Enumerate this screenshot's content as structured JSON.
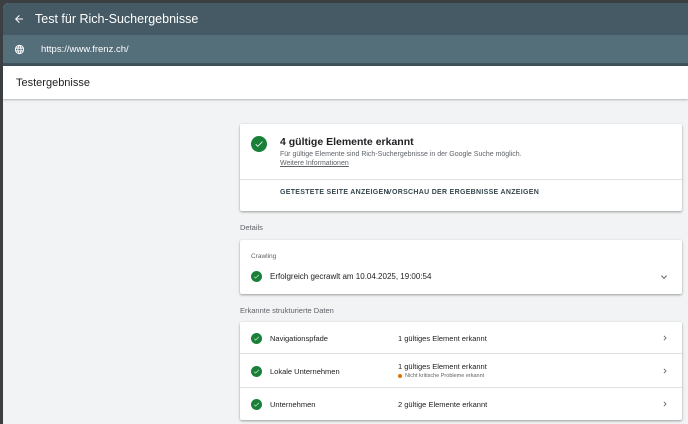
{
  "app": {
    "title": "Test für Rich-Suchergebnisse",
    "url": "https://www.frenz.ch/",
    "page_title": "Testergebnisse"
  },
  "summary": {
    "title": "4 gültige Elemente erkannt",
    "subtitle": "Für gültige Elemente sind Rich-Suchergebnisse in der Google Suche möglich.",
    "link": "Weitere Informationen",
    "action_tested_page": "GETESTETE SEITE ANZEIGEN",
    "action_preview": "VORSCHAU DER ERGEBNISSE ANZEIGEN"
  },
  "details": {
    "label": "Details",
    "crawl_label": "Crawling",
    "crawl_status": "Erfolgreich gecrawlt am 10.04.2025, 19:00:54"
  },
  "structured": {
    "label": "Erkannte strukturierte Daten",
    "rows": [
      {
        "name": "Navigationspfade",
        "status": "1 gültiges Element erkannt",
        "warning": ""
      },
      {
        "name": "Lokale Unternehmen",
        "status": "1 gültiges Element erkannt",
        "warning": "Nicht kritische Probleme erkannt"
      },
      {
        "name": "Unternehmen",
        "status": "2 gültige Elemente erkannt",
        "warning": ""
      }
    ]
  },
  "colors": {
    "topbar": "#455a64",
    "urlbar": "#546e7a",
    "success": "#188038",
    "warning": "#e37400"
  },
  "icons": {
    "back": "arrow-left-icon",
    "globe": "globe-icon",
    "check": "check-circle-icon",
    "expand": "chevron-down-icon",
    "open": "chevron-right-icon"
  }
}
